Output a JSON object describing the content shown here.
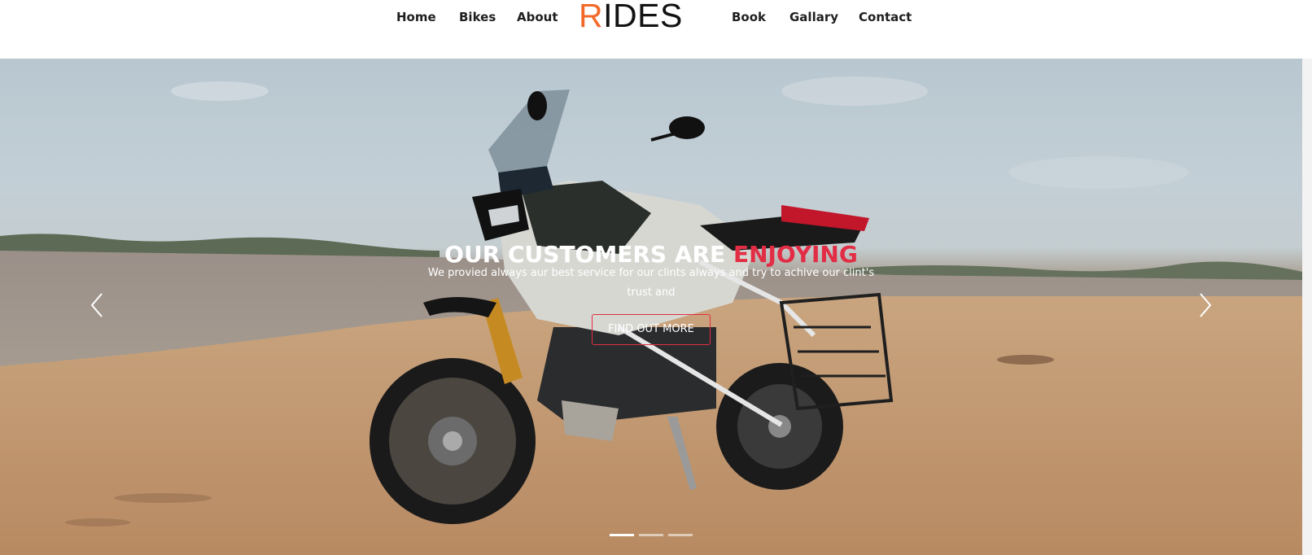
{
  "nav": {
    "left": [
      "Home",
      "Bikes",
      "About"
    ],
    "right": [
      "Book",
      "Gallary",
      "Contact"
    ]
  },
  "brand": {
    "first_letter": "R",
    "rest": "IDES"
  },
  "hero": {
    "title_main": "OUR CUSTOMERS ARE",
    "title_accent": "ENJOYING",
    "subtitle": "We provied always aur best service for our clints always and try to achive our clint's trust and",
    "cta_label": "FIND OUT MORE",
    "active_slide": 1,
    "slide_count": 3
  },
  "colors": {
    "brand_accent": "#f26a2a",
    "hero_accent": "#e22d45"
  },
  "icons": {
    "prev": "chevron-left-icon",
    "next": "chevron-right-icon"
  }
}
